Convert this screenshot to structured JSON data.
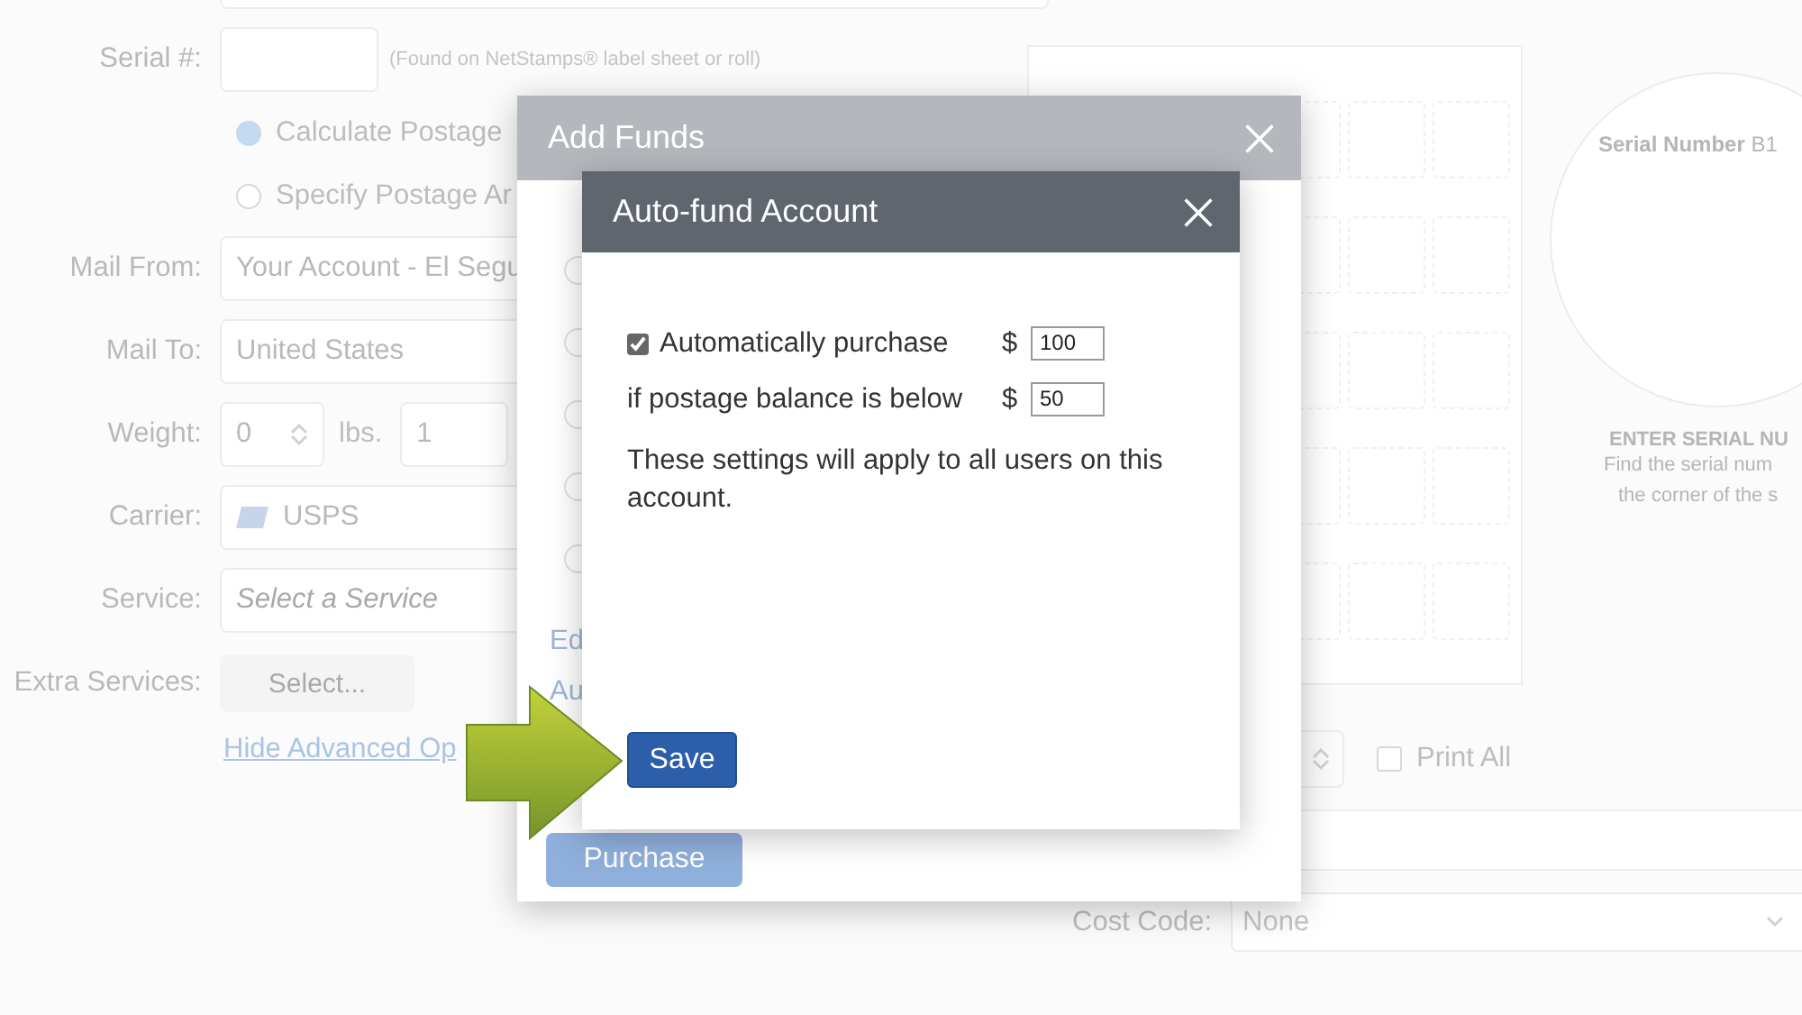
{
  "serial": {
    "label": "Serial #:",
    "hint": "(Found on NetStamps® label sheet or roll)"
  },
  "postage_mode": [
    {
      "label": "Calculate Postage",
      "selected": true
    },
    {
      "label": "Specify Postage Ar",
      "selected": false
    }
  ],
  "fields": [
    {
      "kind": "select",
      "label": "Mail From:",
      "value": "Your Account - El Segu"
    },
    {
      "kind": "select",
      "label": "Mail To:",
      "value": "United States"
    },
    {
      "kind": "weight",
      "label": "Weight:",
      "value": "0",
      "unit": "lbs.",
      "value2": "1"
    },
    {
      "kind": "carrier",
      "label": "Carrier:",
      "value": "USPS"
    },
    {
      "kind": "placeholder",
      "label": "Service:",
      "placeholder": "Select a Service"
    },
    {
      "kind": "button",
      "label": "Extra Services:",
      "button": "Select..."
    }
  ],
  "advanced_link": "Hide Advanced Op",
  "sheet_preview": {
    "serial_label": "**Serial Number** B1",
    "heading": "ENTER SERIAL NU",
    "lines": [
      "Find the serial num",
      "the corner of the s"
    ]
  },
  "print_all": {
    "label": "Print All",
    "checked": false
  },
  "cost_code": {
    "label": "Cost Code:",
    "value": "None"
  },
  "add_funds": {
    "title": "Add Funds",
    "options": [
      {
        "selected": false
      },
      {
        "selected": false
      },
      {
        "selected": false
      },
      {
        "selected": false
      },
      {
        "selected": false
      }
    ],
    "fragments": [
      "Ed",
      "Au"
    ],
    "purchase_button": "Purchase"
  },
  "auto_fund": {
    "title": "Auto-fund Account",
    "auto_purchase": {
      "label": "Automatically purchase",
      "checked": true,
      "currency": "$",
      "value": "100"
    },
    "threshold": {
      "label": "if postage balance is below",
      "currency": "$",
      "value": "50"
    },
    "note": "These settings will apply to all users on this account.",
    "save_button": "Save"
  }
}
